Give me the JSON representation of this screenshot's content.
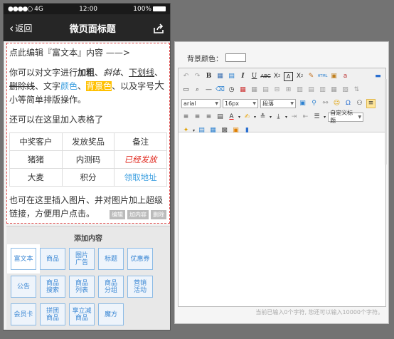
{
  "status": {
    "carrier": "4G",
    "time": "12:00",
    "battery": "100%"
  },
  "nav": {
    "back_label": "返回",
    "title": "微页面标题"
  },
  "content": {
    "line1_a": "点此编辑『富文本』内容 ——>",
    "p2": {
      "t1": "你可以对文字进行",
      "bold": "加粗",
      "t2": "、",
      "italic": "斜体",
      "t3": "、",
      "underline": "下划线",
      "t4": "、",
      "strike": "删除线",
      "t5": "、文字",
      "color": "颜色",
      "t6": "、",
      "bgcolor": "背景色",
      "t7": "、以及字号",
      "big": "大",
      "small": "小",
      "t8": "等简单排版操作。"
    },
    "p3": "还可以在这里加入表格了",
    "table": [
      [
        "中奖客户",
        "发放奖品",
        "备注"
      ],
      [
        "猪猪",
        "内测码",
        "已经发放"
      ],
      [
        "大麦",
        "积分",
        "领取地址"
      ]
    ],
    "p4": "也可在这里插入图片、并对图片加上超级链接，方便用户点击。",
    "tools": {
      "edit": "编辑",
      "add": "加内容",
      "delete": "删除"
    }
  },
  "add_panel": {
    "title": "添加内容",
    "buttons": [
      "富文本",
      "商品",
      "图片\n广告",
      "标题",
      "优惠券",
      "公告",
      "商品\n搜索",
      "商品\n列表",
      "商品\n分组",
      "营销\n活动",
      "会员卡",
      "拼团\n商品",
      "享立减\n商品",
      "魔方"
    ]
  },
  "editor": {
    "bg_label": "背景颜色：",
    "font": "arial",
    "size": "16px",
    "paragraph": "段落",
    "custom_title": "自定义标题",
    "status": "当前已输入0个字符, 您还可以输入10000个字符。"
  }
}
